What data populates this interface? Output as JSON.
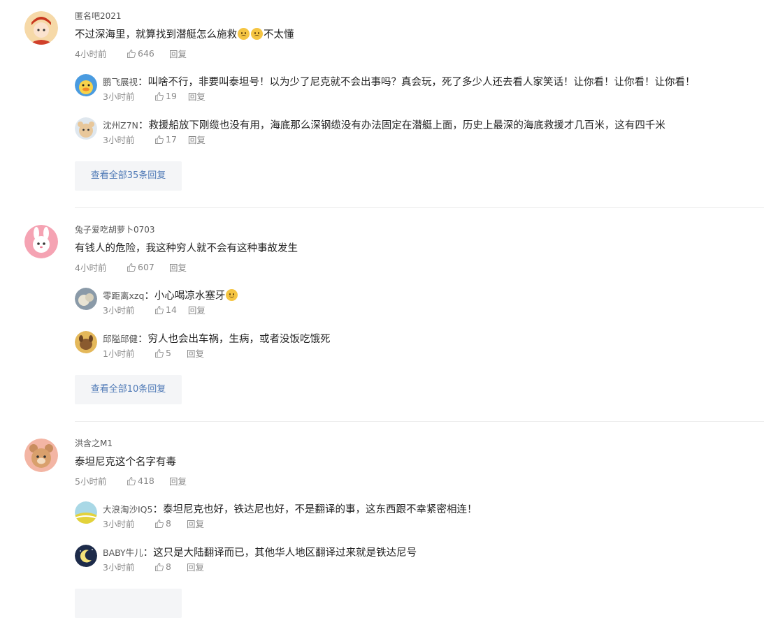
{
  "threads": [
    {
      "username": "匿名吧2021",
      "text_before": "不过深海里，就算找到潜艇怎么施救",
      "text_after": "不太懂",
      "emojis": [
        "sad-face-emoji",
        "sad-face-emoji"
      ],
      "time": "4小时前",
      "likes": "646",
      "reply_label": "回复",
      "replies": [
        {
          "name": "鹏飞展视",
          "text": "叫啥不行，非要叫泰坦号！以为少了尼克就不会出事吗？真会玩，死了多少人还去看人家笑话！让你看！让你看！让你看！",
          "time": "3小时前",
          "likes": "19",
          "reply_label": "回复"
        },
        {
          "name": "沈州Z7N",
          "text": "救援船放下刚缆也没有用，海底那么深钢缆没有办法固定在潜艇上面，历史上最深的海底救援才几百米，这有四千米",
          "time": "3小时前",
          "likes": "17",
          "reply_label": "回复"
        }
      ],
      "more_label": "查看全部35条回复"
    },
    {
      "username": "兔子爱吃胡萝卜0703",
      "text_before": "有钱人的危险，我这种穷人就不会有这种事故发生",
      "text_after": "",
      "emojis": [],
      "time": "4小时前",
      "likes": "607",
      "reply_label": "回复",
      "replies": [
        {
          "name": "零距离xzq",
          "text": "小心喝凉水塞牙",
          "emoji": "smile-emoji",
          "time": "3小时前",
          "likes": "14",
          "reply_label": "回复"
        },
        {
          "name": "邱隘邱健",
          "text": "穷人也会出车祸，生病，或者没饭吃饿死",
          "time": "1小时前",
          "likes": "5",
          "reply_label": "回复"
        }
      ],
      "more_label": "查看全部10条回复"
    },
    {
      "username": "洪含之M1",
      "text_before": "泰坦尼克这个名字有毒",
      "text_after": "",
      "emojis": [],
      "time": "5小时前",
      "likes": "418",
      "reply_label": "回复",
      "replies": [
        {
          "name": "大浪淘沙IQ5",
          "text": "泰坦尼克也好，铁达尼也好，不是翻译的事，这东西跟不幸紧密相连！",
          "time": "3小时前",
          "likes": "8",
          "reply_label": "回复"
        },
        {
          "name": "BABY牛儿",
          "text": "这只是大陆翻译而已，其他华人地区翻译过来就是铁达尼号",
          "time": "3小时前",
          "likes": "8",
          "reply_label": "回复"
        }
      ]
    }
  ],
  "colors": {
    "link": "#4e79b6",
    "meta": "#888888",
    "button_bg": "#f4f5f7"
  }
}
